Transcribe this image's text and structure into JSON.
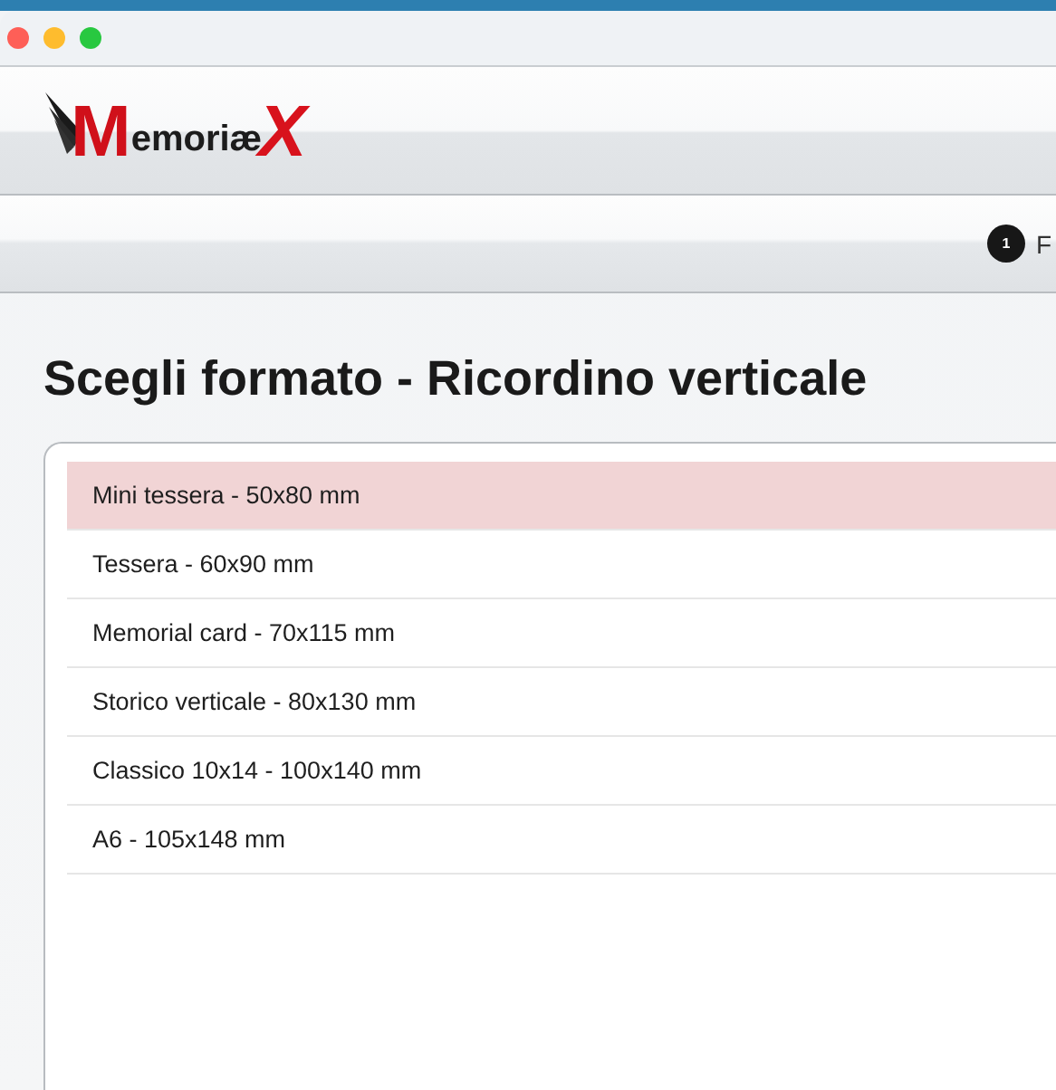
{
  "logo": {
    "initial": "M",
    "middle": "emoriæ",
    "final": "X"
  },
  "steps": [
    {
      "number": "1",
      "label": "F",
      "selected": true
    }
  ],
  "heading": "Scegli formato - Ricordino verticale",
  "formats": [
    {
      "label": "Mini tessera - 50x80 mm",
      "selected": true
    },
    {
      "label": "Tessera - 60x90 mm",
      "selected": false
    },
    {
      "label": "Memorial card - 70x115 mm",
      "selected": false
    },
    {
      "label": "Storico verticale - 80x130 mm",
      "selected": false
    },
    {
      "label": "Classico 10x14 - 100x140 mm",
      "selected": false
    },
    {
      "label": "A6 - 105x148 mm",
      "selected": false
    }
  ]
}
